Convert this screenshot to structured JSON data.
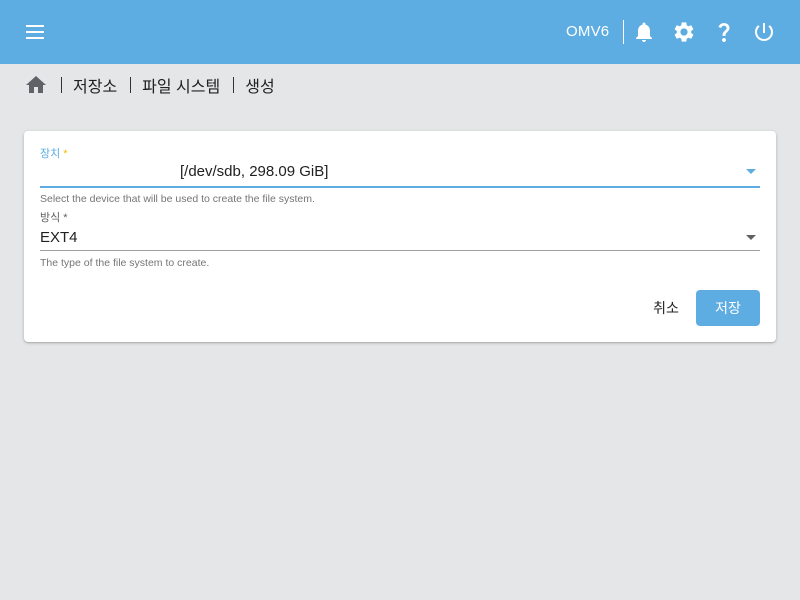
{
  "header": {
    "hostname": "OMV6",
    "icons": [
      "menu-icon",
      "bell-icon",
      "gear-icon",
      "help-icon",
      "power-icon"
    ],
    "background_color": "#5dade2"
  },
  "breadcrumb": {
    "home_icon": "home-icon",
    "items": [
      "저장소",
      "파일 시스템",
      "생성"
    ]
  },
  "form": {
    "device": {
      "label": "장치",
      "required_mark": "*",
      "value": "[/dev/sdb, 298.09 GiB]",
      "hint": "Select the device that will be used to create the file system.",
      "focused": true
    },
    "method": {
      "label": "방식",
      "required_mark": "*",
      "value": "EXT4",
      "hint": "The type of the file system to create."
    }
  },
  "actions": {
    "cancel_label": "취소",
    "save_label": "저장"
  },
  "colors": {
    "accent": "#5dade2",
    "required_focused": "#f5b800",
    "page_background": "#e5e6e7"
  }
}
